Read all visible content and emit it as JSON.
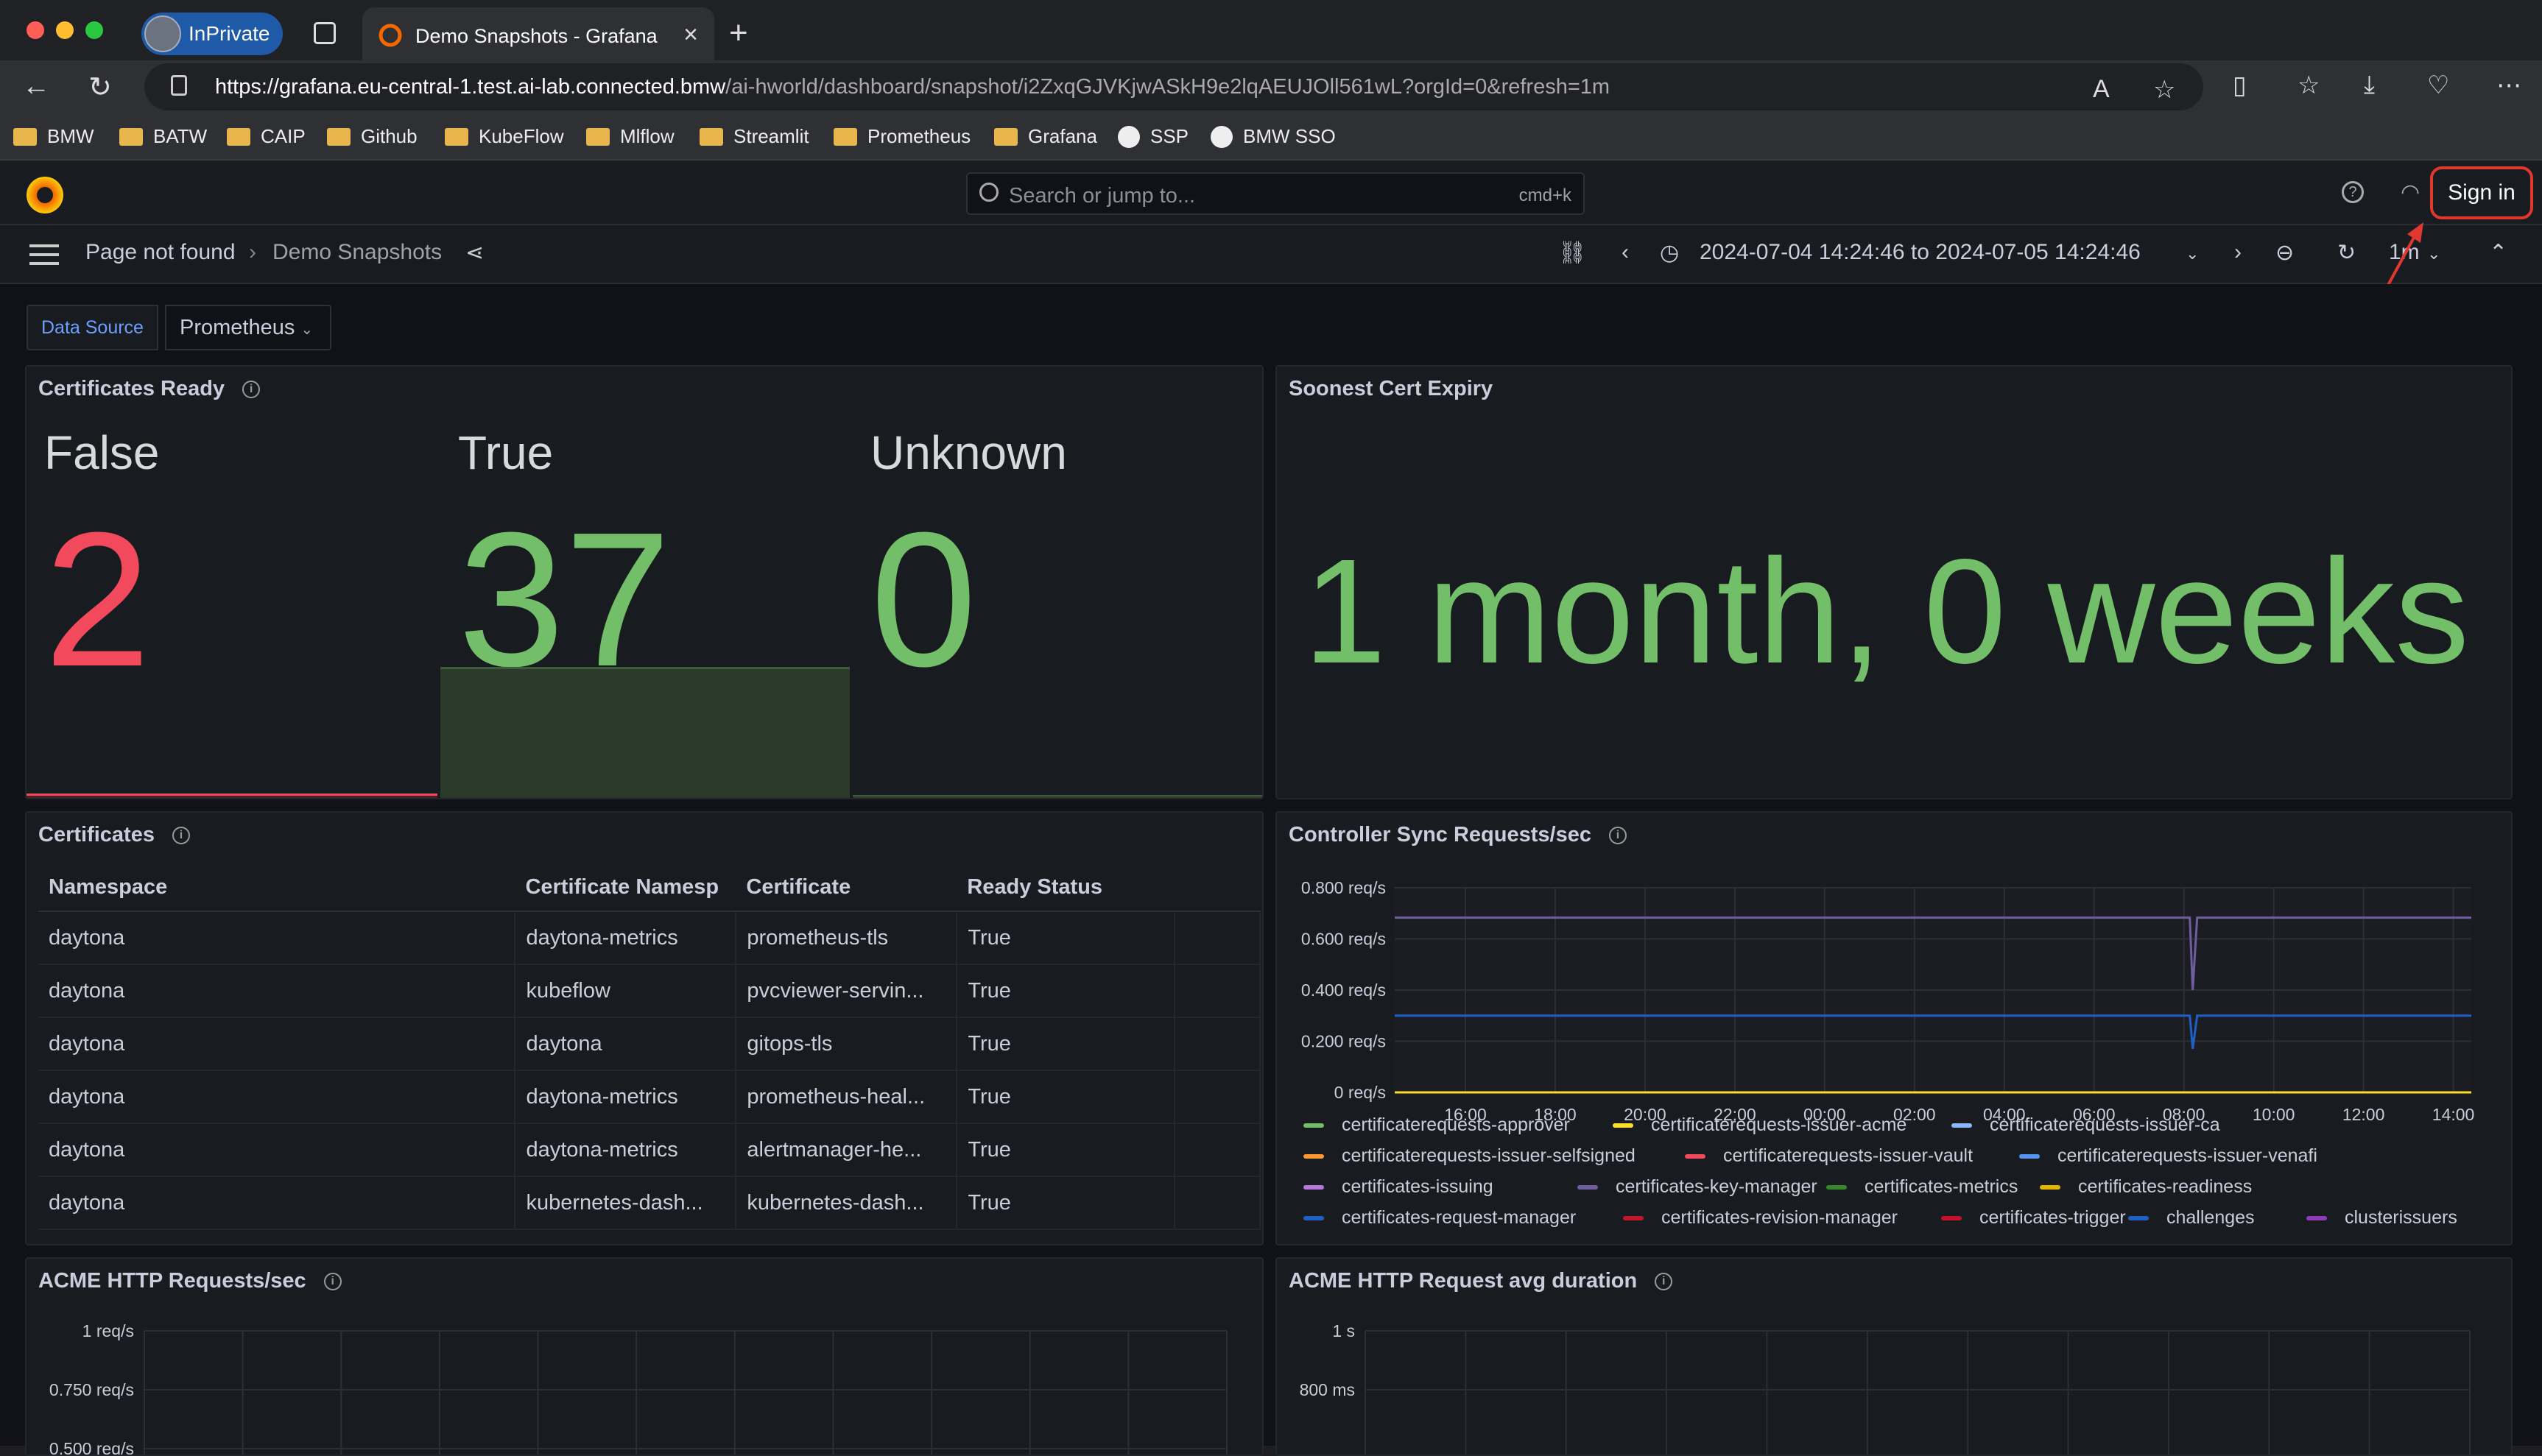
{
  "browser": {
    "inprivate_label": "InPrivate",
    "tab_title": "Demo Snapshots - Grafana",
    "url_host": "https://grafana.eu-central-1.test.ai-lab.connected.bmw",
    "url_path": "/ai-hworld/dashboard/snapshot/i2ZxqGJVKjwASkH9e2lqAEUJOll561wL?orgId=0&refresh=1m",
    "bookmarks": [
      "BMW",
      "BATW",
      "CAIP",
      "Github",
      "KubeFlow",
      "Mlflow",
      "Streamlit",
      "Prometheus",
      "Grafana",
      "SSP",
      "BMW SSO"
    ]
  },
  "grafana": {
    "search_placeholder": "Search or jump to...",
    "search_shortcut": "cmd+k",
    "sign_in": "Sign in",
    "breadcrumb": [
      "Page not found",
      "Demo Snapshots"
    ],
    "time_range": "2024-07-04 14:24:46 to 2024-07-05 14:24:46",
    "refresh": "1m",
    "var_label": "Data Source",
    "var_value": "Prometheus",
    "colors": {
      "green": "#73bf69",
      "red": "#f2495c"
    }
  },
  "panels": {
    "cert_ready": {
      "title": "Certificates Ready",
      "stats": [
        {
          "label": "False",
          "value": "2",
          "color": "#f2495c"
        },
        {
          "label": "True",
          "value": "37",
          "color": "#73bf69"
        },
        {
          "label": "Unknown",
          "value": "0",
          "color": "#73bf69"
        }
      ]
    },
    "soonest": {
      "title": "Soonest Cert Expiry",
      "value": "1 month, 0 weeks"
    },
    "certs_table": {
      "title": "Certificates",
      "columns": [
        "Namespace",
        "Certificate Namesp",
        "Certificate",
        "Ready Status"
      ],
      "rows": [
        [
          "daytona",
          "daytona-metrics",
          "prometheus-tls",
          "True"
        ],
        [
          "daytona",
          "kubeflow",
          "pvcviewer-servin...",
          "True"
        ],
        [
          "daytona",
          "daytona",
          "gitops-tls",
          "True"
        ],
        [
          "daytona",
          "daytona-metrics",
          "prometheus-heal...",
          "True"
        ],
        [
          "daytona",
          "daytona-metrics",
          "alertmanager-he...",
          "True"
        ],
        [
          "daytona",
          "kubernetes-dash...",
          "kubernetes-dash...",
          "True"
        ]
      ]
    },
    "sync": {
      "title": "Controller Sync Requests/sec",
      "y_ticks": [
        "0.800 req/s",
        "0.600 req/s",
        "0.400 req/s",
        "0.200 req/s",
        "0 req/s"
      ],
      "x_ticks": [
        "16:00",
        "18:00",
        "20:00",
        "22:00",
        "00:00",
        "02:00",
        "04:00",
        "06:00",
        "08:00",
        "10:00",
        "12:00",
        "14:00"
      ],
      "legend": [
        {
          "name": "certificaterequests-approver",
          "color": "#73bf69"
        },
        {
          "name": "certificaterequests-issuer-acme",
          "color": "#fade2a"
        },
        {
          "name": "certificaterequests-issuer-ca",
          "color": "#8ab8ff"
        },
        {
          "name": "certificaterequests-issuer-selfsigned",
          "color": "#ff9830"
        },
        {
          "name": "certificaterequests-issuer-vault",
          "color": "#f2495c"
        },
        {
          "name": "certificaterequests-issuer-venafi",
          "color": "#5794f2"
        },
        {
          "name": "certificates-issuing",
          "color": "#b877d9"
        },
        {
          "name": "certificates-key-manager",
          "color": "#705da0"
        },
        {
          "name": "certificates-metrics",
          "color": "#37872d"
        },
        {
          "name": "certificates-readiness",
          "color": "#e0b400"
        },
        {
          "name": "certificates-request-manager",
          "color": "#1f60c4"
        },
        {
          "name": "certificates-revision-manager",
          "color": "#c4162a"
        },
        {
          "name": "certificates-trigger",
          "color": "#c8102e"
        },
        {
          "name": "challenges",
          "color": "#1f60c4"
        },
        {
          "name": "clusterissuers",
          "color": "#8f3bb8"
        }
      ]
    },
    "acme_http": {
      "title": "ACME HTTP Requests/sec",
      "y_ticks": [
        "1 req/s",
        "0.750 req/s",
        "0.500 req/s"
      ]
    },
    "acme_dur": {
      "title": "ACME HTTP Request avg duration",
      "y_ticks": [
        "1 s",
        "800 ms"
      ]
    }
  },
  "chart_data": {
    "type": "line",
    "title": "Controller Sync Requests/sec",
    "xlabel": "",
    "ylabel": "",
    "ylim": [
      0,
      0.8
    ],
    "x": [
      "14:24",
      "16:00",
      "18:00",
      "20:00",
      "22:00",
      "00:00",
      "02:00",
      "04:00",
      "06:00",
      "08:00",
      "08:10",
      "08:20",
      "10:00",
      "12:00",
      "14:24"
    ],
    "series": [
      {
        "name": "certificates-key-manager",
        "values": [
          0.683,
          0.683,
          0.683,
          0.683,
          0.683,
          0.683,
          0.683,
          0.683,
          0.683,
          0.683,
          0.4,
          0.683,
          0.683,
          0.683,
          0.683
        ]
      },
      {
        "name": "challenges",
        "values": [
          0.3,
          0.3,
          0.3,
          0.3,
          0.3,
          0.3,
          0.3,
          0.3,
          0.3,
          0.3,
          0.17,
          0.3,
          0.3,
          0.3,
          0.3
        ]
      }
    ]
  }
}
